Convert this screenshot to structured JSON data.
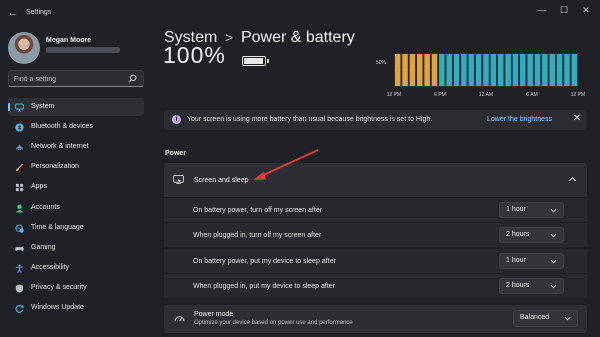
{
  "window": {
    "app_title": "Settings",
    "back_icon": "back-arrow-icon",
    "minimize_glyph": "—",
    "maximize_glyph": "☐",
    "close_glyph": "✕"
  },
  "user": {
    "name": "Megan Moore"
  },
  "search": {
    "placeholder": "Find a setting"
  },
  "nav": [
    {
      "label": "System",
      "icon": "monitor-icon",
      "color": "#4cc2ff"
    },
    {
      "label": "Bluetooth & devices",
      "icon": "bluetooth-icon",
      "color": "#4cc2ff"
    },
    {
      "label": "Network & internet",
      "icon": "network-icon",
      "color": "#6fc0ef"
    },
    {
      "label": "Personalization",
      "icon": "brush-icon",
      "color": "#f0a35e"
    },
    {
      "label": "Apps",
      "icon": "apps-icon",
      "color": "#b9c3cf"
    },
    {
      "label": "Accounts",
      "icon": "account-icon",
      "color": "#4ccf8f"
    },
    {
      "label": "Time & language",
      "icon": "globe-clock-icon",
      "color": "#5fb8ef"
    },
    {
      "label": "Gaming",
      "icon": "gamepad-icon",
      "color": "#b9c3cf"
    },
    {
      "label": "Accessibility",
      "icon": "accessibility-icon",
      "color": "#5fb8ef"
    },
    {
      "label": "Privacy & security",
      "icon": "shield-icon",
      "color": "#b9c3cf"
    },
    {
      "label": "Windows Update",
      "icon": "update-icon",
      "color": "#4cc2ff"
    }
  ],
  "breadcrumb": {
    "parent": "System",
    "separator": ">",
    "current": "Power & battery"
  },
  "battery": {
    "percent_text": "100%",
    "level": 1.0
  },
  "chart_data": {
    "type": "bar",
    "x_tick_labels": [
      "12 PM",
      "6 PM",
      "12 AM",
      "6 AM",
      "12 PM"
    ],
    "y_tick_labels": [
      "50%"
    ],
    "ylim": [
      0,
      100
    ],
    "values": [
      100,
      100,
      100,
      100,
      100,
      100,
      100,
      100,
      100,
      100,
      100,
      100,
      100,
      100,
      100,
      100,
      100,
      100,
      100,
      100,
      100,
      100,
      100,
      100,
      100
    ],
    "bar_colors": [
      "#e0a43a",
      "#e0a43a",
      "#e0a43a",
      "#e0a43a",
      "#e0a43a",
      "#e0a43a",
      "#2bb0c2",
      "#2bb0c2",
      "#2bb0c2",
      "#2bb0c2",
      "#2bb0c2",
      "#2bb0c2",
      "#2bb0c2",
      "#2bb0c2",
      "#2bb0c2",
      "#2bb0c2",
      "#2bb0c2",
      "#2bb0c2",
      "#2bb0c2",
      "#2bb0c2",
      "#2bb0c2",
      "#2bb0c2",
      "#2bb0c2",
      "#2bb0c2",
      "#2bb0c2"
    ],
    "grid": true
  },
  "notice": {
    "text": "Your screen is using more battery than usual because brightness is set to High.",
    "link": "Lower the brightness",
    "close_glyph": "✕",
    "accent": "#c6a6e8"
  },
  "power_section": {
    "heading": "Power",
    "screen_sleep": {
      "title": "Screen and sleep",
      "rows": [
        {
          "label": "On battery power, turn off my screen after",
          "value": "1 hour"
        },
        {
          "label": "When plugged in, turn off my screen after",
          "value": "2 hours"
        },
        {
          "label": "On battery power, put my device to sleep after",
          "value": "1 hour"
        },
        {
          "label": "When plugged in, put my device to sleep after",
          "value": "2 hours"
        }
      ]
    },
    "power_mode": {
      "title": "Power mode",
      "description": "Optimize your device based on power use and performance",
      "value": "Balanced"
    }
  },
  "annotation": {
    "arrow_color": "#e03a3a"
  }
}
